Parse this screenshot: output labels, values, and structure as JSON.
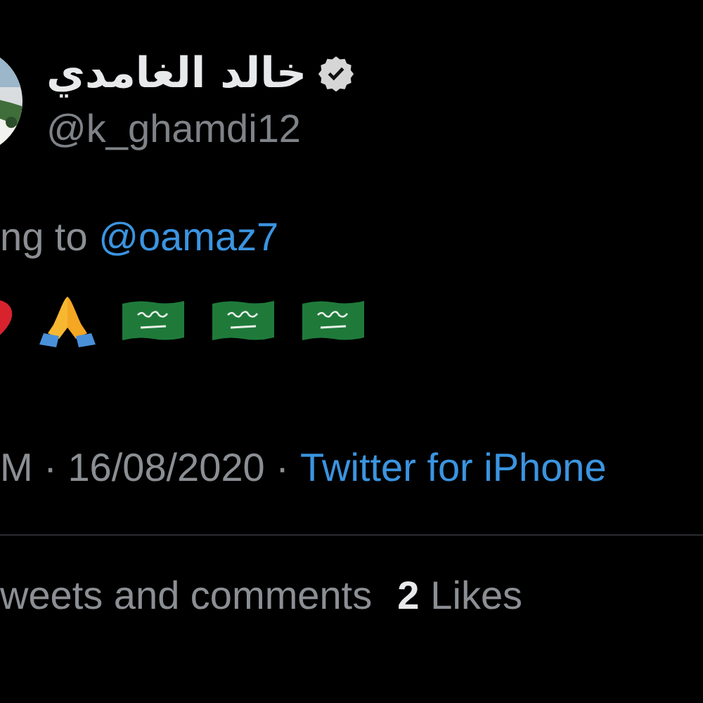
{
  "author": {
    "name": "خالد الغامدي",
    "verified": true,
    "handle": "@k_ghamdi12"
  },
  "reply": {
    "prefix": "ng to",
    "mention": "@oamaz7"
  },
  "emojis": [
    {
      "kind": "heart"
    },
    {
      "kind": "pray"
    },
    {
      "kind": "flag"
    },
    {
      "kind": "flag"
    },
    {
      "kind": "flag"
    }
  ],
  "meta": {
    "time_date": "M · 16/08/2020 ·",
    "source": "Twitter for iPhone"
  },
  "stats": [
    {
      "label": "weets and comments"
    },
    {
      "count": "2",
      "label": "Likes"
    }
  ]
}
